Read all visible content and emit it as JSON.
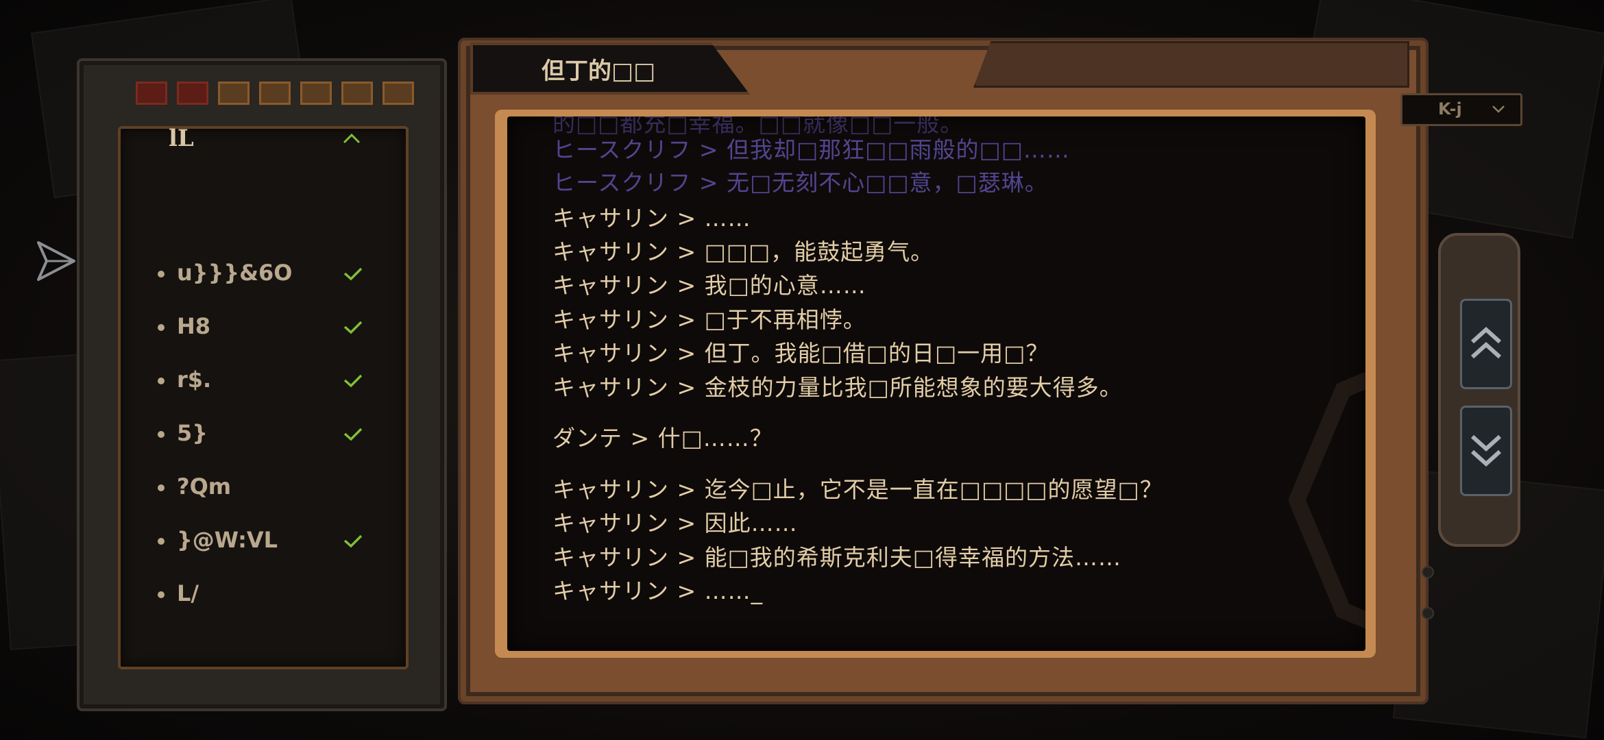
{
  "window": {
    "tab_title": "但丁的□□",
    "language_value": "K-j"
  },
  "chapter_panel": {
    "header": "lL",
    "items": [
      {
        "label": "u}}}&6O",
        "completed": true
      },
      {
        "label": "H8",
        "completed": true
      },
      {
        "label": "r$.",
        "completed": true
      },
      {
        "label": "5}",
        "completed": true
      },
      {
        "label": "?Qm",
        "completed": false
      },
      {
        "label": "}@W:VL",
        "completed": true
      },
      {
        "label": "L/",
        "completed": false
      }
    ]
  },
  "log": {
    "partial_top": "的□□都充□幸福。□□就像□□一般。",
    "lines": [
      {
        "speaker": "ヒースクリフ",
        "text": "ヒースクリフ > 但我却□那狂□□雨般的□□……",
        "style": "purple"
      },
      {
        "speaker": "ヒースクリフ",
        "text": "ヒースクリフ > 无□无刻不心□□意，□瑟琳。",
        "style": "purple"
      },
      {
        "speaker": "キャサリン",
        "text": "キャサリン > ……",
        "style": "amber"
      },
      {
        "speaker": "キャサリン",
        "text": "キャサリン > □□□，能鼓起勇气。",
        "style": "amber"
      },
      {
        "speaker": "キャサリン",
        "text": "キャサリン > 我□的心意……",
        "style": "amber"
      },
      {
        "speaker": "キャサリン",
        "text": "キャサリン > □于不再相悖。",
        "style": "amber"
      },
      {
        "speaker": "キャサリン",
        "text": "キャサリン > 但丁。我能□借□的日□一用□？",
        "style": "amber"
      },
      {
        "speaker": "キャサリン",
        "text": "キャサリン > 金枝的力量比我□所能想象的要大得多。",
        "style": "amber"
      },
      {
        "speaker": "ダンテ",
        "text": "ダンテ > 什□……？",
        "style": "amber"
      },
      {
        "speaker": "キャサリン",
        "text": "キャサリン > 迄今□止，它不是一直在□□□□的愿望□？",
        "style": "amber"
      },
      {
        "speaker": "キャサリン",
        "text": "キャサリン > 因此……",
        "style": "amber"
      },
      {
        "speaker": "キャサリン",
        "text": "キャサリン > 能□我的希斯克利夫□得幸福的方法……",
        "style": "amber"
      },
      {
        "speaker": "キャサリン",
        "text": "キャサリン > ……_",
        "style": "amber"
      }
    ]
  },
  "colors": {
    "accent_check": "#7fbf3a",
    "speaker_purple": "#51458f",
    "text_amber": "#e2cda6",
    "frame_copper": "#c48a52"
  },
  "icons": {
    "share": "share-icon",
    "chevron": "chevron-up-icon",
    "check": "check-icon",
    "scroll_up": "double-chevron-up-icon",
    "scroll_down": "double-chevron-down-icon"
  }
}
